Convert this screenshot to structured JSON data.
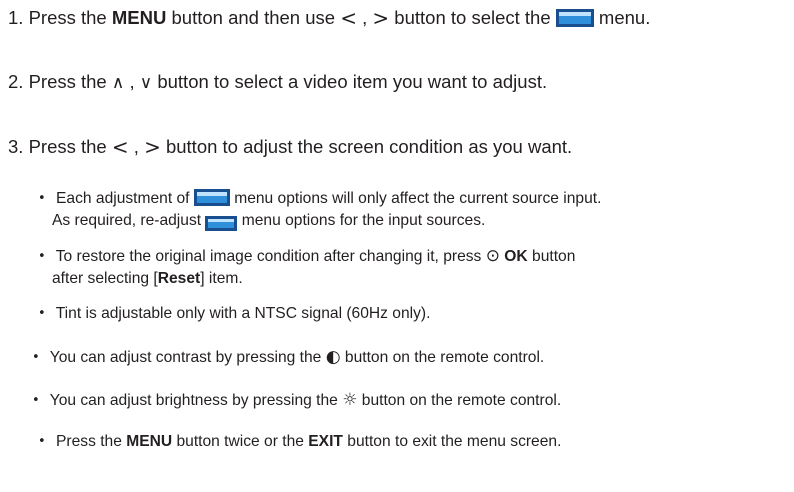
{
  "steps": [
    {
      "num": "1.",
      "t1": "Press the",
      "menu": "MENU",
      "t2": "button and then use",
      "left": "<",
      "comma": ",",
      "right": ">",
      "t3": "button to select the",
      "icon": "video-menu-icon",
      "t4": "menu."
    },
    {
      "num": "2.",
      "t1": "Press the",
      "up": "∧",
      "comma": ",",
      "down": "∨",
      "t2": "button to select a video item you want to adjust."
    },
    {
      "num": "3.",
      "t1": "Press the",
      "left": "<",
      "comma": ",",
      "right": ">",
      "t2": "button to adjust the screen condition as you want."
    }
  ],
  "notes": {
    "b1": {
      "l1a": "Each adjustment of",
      "l1b": "menu options will only affect the current source input.",
      "l2a": "As required, re-adjust",
      "l2b": "menu options for the input sources.",
      "icon": "video-menu-icon"
    },
    "b2": {
      "l1a": "To restore the original image condition after changing it, press",
      "ok_symbol": "⊙",
      "ok": "OK",
      "l1b": "button",
      "l2a": "after selecting [",
      "reset": "Reset",
      "l2b": "] item."
    },
    "b3": "Tint is adjustable only with a NTSC signal (60Hz only).",
    "b4": {
      "a": "You can adjust contrast by pressing the",
      "symbol": "◐",
      "b": "button on the remote control."
    },
    "b5": {
      "a": "You can adjust brightness by pressing the",
      "symbol": "☼",
      "b": "button on the remote control."
    },
    "b6": {
      "a": "Press the",
      "menu": "MENU",
      "b": "button twice or the",
      "exit": "EXIT",
      "c": "button to exit the menu screen."
    }
  },
  "bullet_char": "•",
  "colors": {
    "text": "#231f20",
    "icon_frame": "#1a4f8f",
    "icon_screen": "#2f8fdb",
    "icon_glare": "#bfe3ff"
  }
}
